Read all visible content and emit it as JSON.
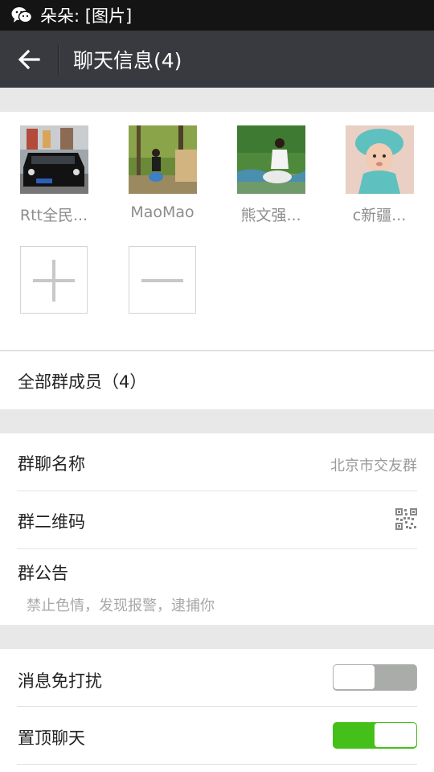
{
  "status_bar": {
    "notification": "朵朵: [图片]",
    "app_icon": "wechat-icon"
  },
  "header": {
    "back_icon": "back-arrow-icon",
    "title": "聊天信息(4)"
  },
  "members": [
    {
      "name": "Rtt全民..."
    },
    {
      "name": "MaoMao"
    },
    {
      "name": "熊文强..."
    },
    {
      "name": "c新疆..."
    }
  ],
  "add_member_icon": "plus-icon",
  "remove_member_icon": "minus-icon",
  "all_members": {
    "label": "全部群成员（4）"
  },
  "group_name": {
    "label": "群聊名称",
    "value": "北京市交友群"
  },
  "group_qr": {
    "label": "群二维码",
    "icon": "qr-code-icon"
  },
  "announcement": {
    "label": "群公告",
    "text": "禁止色情，发现报警，逮捕你"
  },
  "mute": {
    "label": "消息免打扰",
    "state": "off"
  },
  "pin": {
    "label": "置顶聊天",
    "state": "on"
  },
  "colors": {
    "accent_green": "#45c01a",
    "title_bar": "#393a3f",
    "status_bar": "#141414"
  }
}
